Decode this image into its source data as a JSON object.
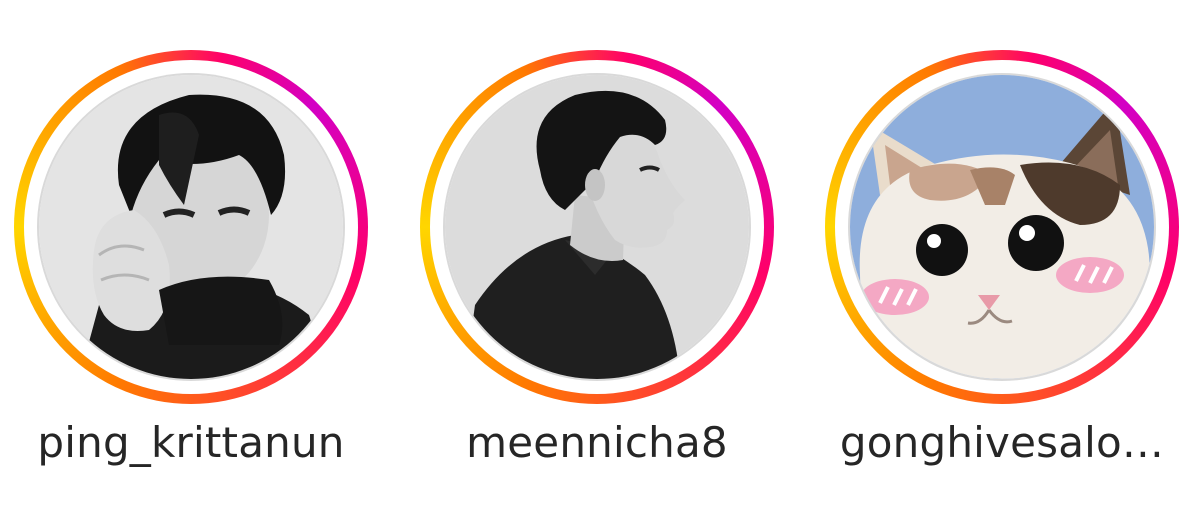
{
  "stories": [
    {
      "username": "ping_krittanun",
      "avatar_icon": "avatar-photo-man-hand-over-face"
    },
    {
      "username": "meennicha8",
      "avatar_icon": "avatar-photo-man-profile"
    },
    {
      "username": "gonghivesalo…",
      "avatar_icon": "avatar-cat-blushing"
    }
  ],
  "colors": {
    "ring_gradient": [
      "#d300c5",
      "#ff0069",
      "#ff7a00",
      "#ffd600"
    ],
    "username_text": "#262626",
    "background": "#ffffff"
  }
}
